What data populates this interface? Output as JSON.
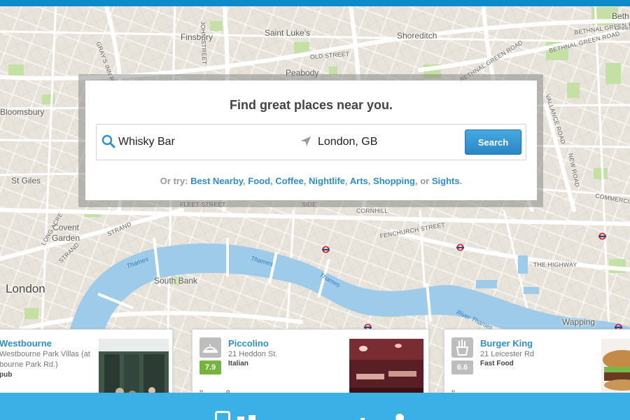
{
  "map": {
    "places": [
      "Finsbury",
      "Saint Luke's",
      "Shoreditch",
      "Peabody",
      "Bloomsbury",
      "St Giles",
      "Covent Garden",
      "South Bank",
      "London",
      "Wapping",
      "Beth"
    ],
    "streets": [
      "JOHN STREET",
      "OLD STREET",
      "BETHNAL GREEN ROAD",
      "BETHNAL GREEN ROAD",
      "BETHNAL GREEN ROAD",
      "GRAY'S INN ROAD",
      "VALLANCE ROAD",
      "NEW ROAD",
      "COMMERCIAL ROAD",
      "LONG ACRE",
      "STRAND",
      "STRAND",
      "FLEET STREET",
      "SIDE",
      "CORNHILL",
      "FENCHURCH STREET",
      "THE HIGHWAY",
      "Green"
    ],
    "river": [
      "Thames",
      "Thames",
      "Thames",
      "River Thames"
    ]
  },
  "search": {
    "title": "Find great places near you.",
    "query_value": "Whisky Bar",
    "near_value": "London, GB",
    "button_label": "Search",
    "suggest_prefix": "Or try:",
    "suggestions": [
      "Best Nearby",
      "Food",
      "Coffee",
      "Nightlife",
      "Arts",
      "Shopping",
      "Sights"
    ],
    "suggest_or": "or",
    "sep": ","
  },
  "venues": [
    {
      "name": "Westbourne",
      "address1": "Westbourne Park Villas (at",
      "address2": "bourne Park Rd.)",
      "category": "pub",
      "quote": ""
    },
    {
      "name": "Piccolino",
      "address1": "21 Heddon St.",
      "category": "Italian",
      "score": "7.9",
      "score_color": "#73b43c",
      "quote": "\"... ... & ... ... ..."
    },
    {
      "name": "Burger King",
      "address1": "21 Leicester Rd",
      "category": "Fast Food",
      "score": "6.6",
      "score_color": "#bdbdbd",
      "quote": "\"..... ...... ..... ...."
    }
  ],
  "colors": {
    "accent": "#2d8fcc",
    "top_bar": "#0d8ac9",
    "bottom_bar": "#3ab0e6",
    "water": "#9fcbeb",
    "park": "#c5e0a5"
  }
}
